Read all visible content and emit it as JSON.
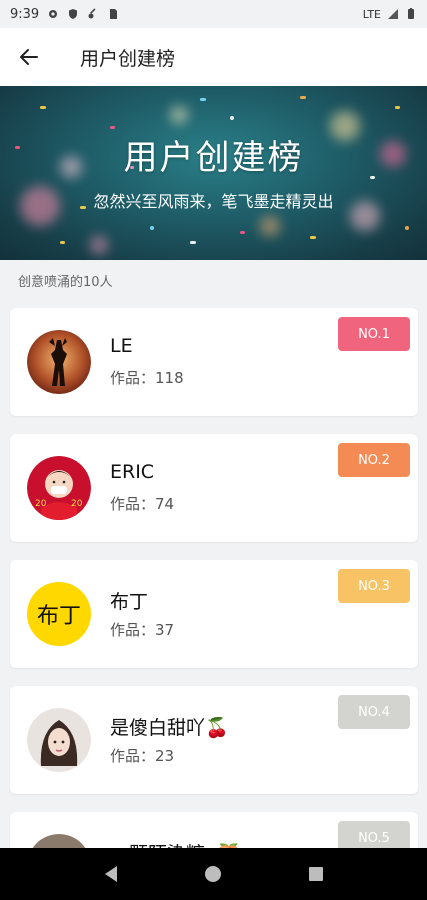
{
  "status_bar": {
    "time": "9:39",
    "network": "LTE"
  },
  "app_bar": {
    "title": "用户创建榜"
  },
  "banner": {
    "title": "用户创建榜",
    "subtitle": "忽然兴至风雨来，笔飞墨走精灵出"
  },
  "section_label": "创意喷涌的10人",
  "users": [
    {
      "name": "LE",
      "works": "作品：118",
      "rank": "NO.1",
      "rank_color": "#f1647e"
    },
    {
      "name": "ERIC",
      "works": "作品：74",
      "rank": "NO.2",
      "rank_color": "#f48a54"
    },
    {
      "name": "布丁",
      "works": "作品：37",
      "rank": "NO.3",
      "rank_color": "#f8c364",
      "avatar_text": "布丁"
    },
    {
      "name": "是傻白甜吖🍒",
      "works": "作品：23",
      "rank": "NO.4",
      "rank_color": "#d3d3d0"
    },
    {
      "name": "一颗陌染糖o🍑",
      "works": "",
      "rank": "NO.5",
      "rank_color": "#d3d3d0"
    }
  ],
  "colors": {
    "accent_teal": "#1f5f6a",
    "background": "#f1f2f4"
  }
}
